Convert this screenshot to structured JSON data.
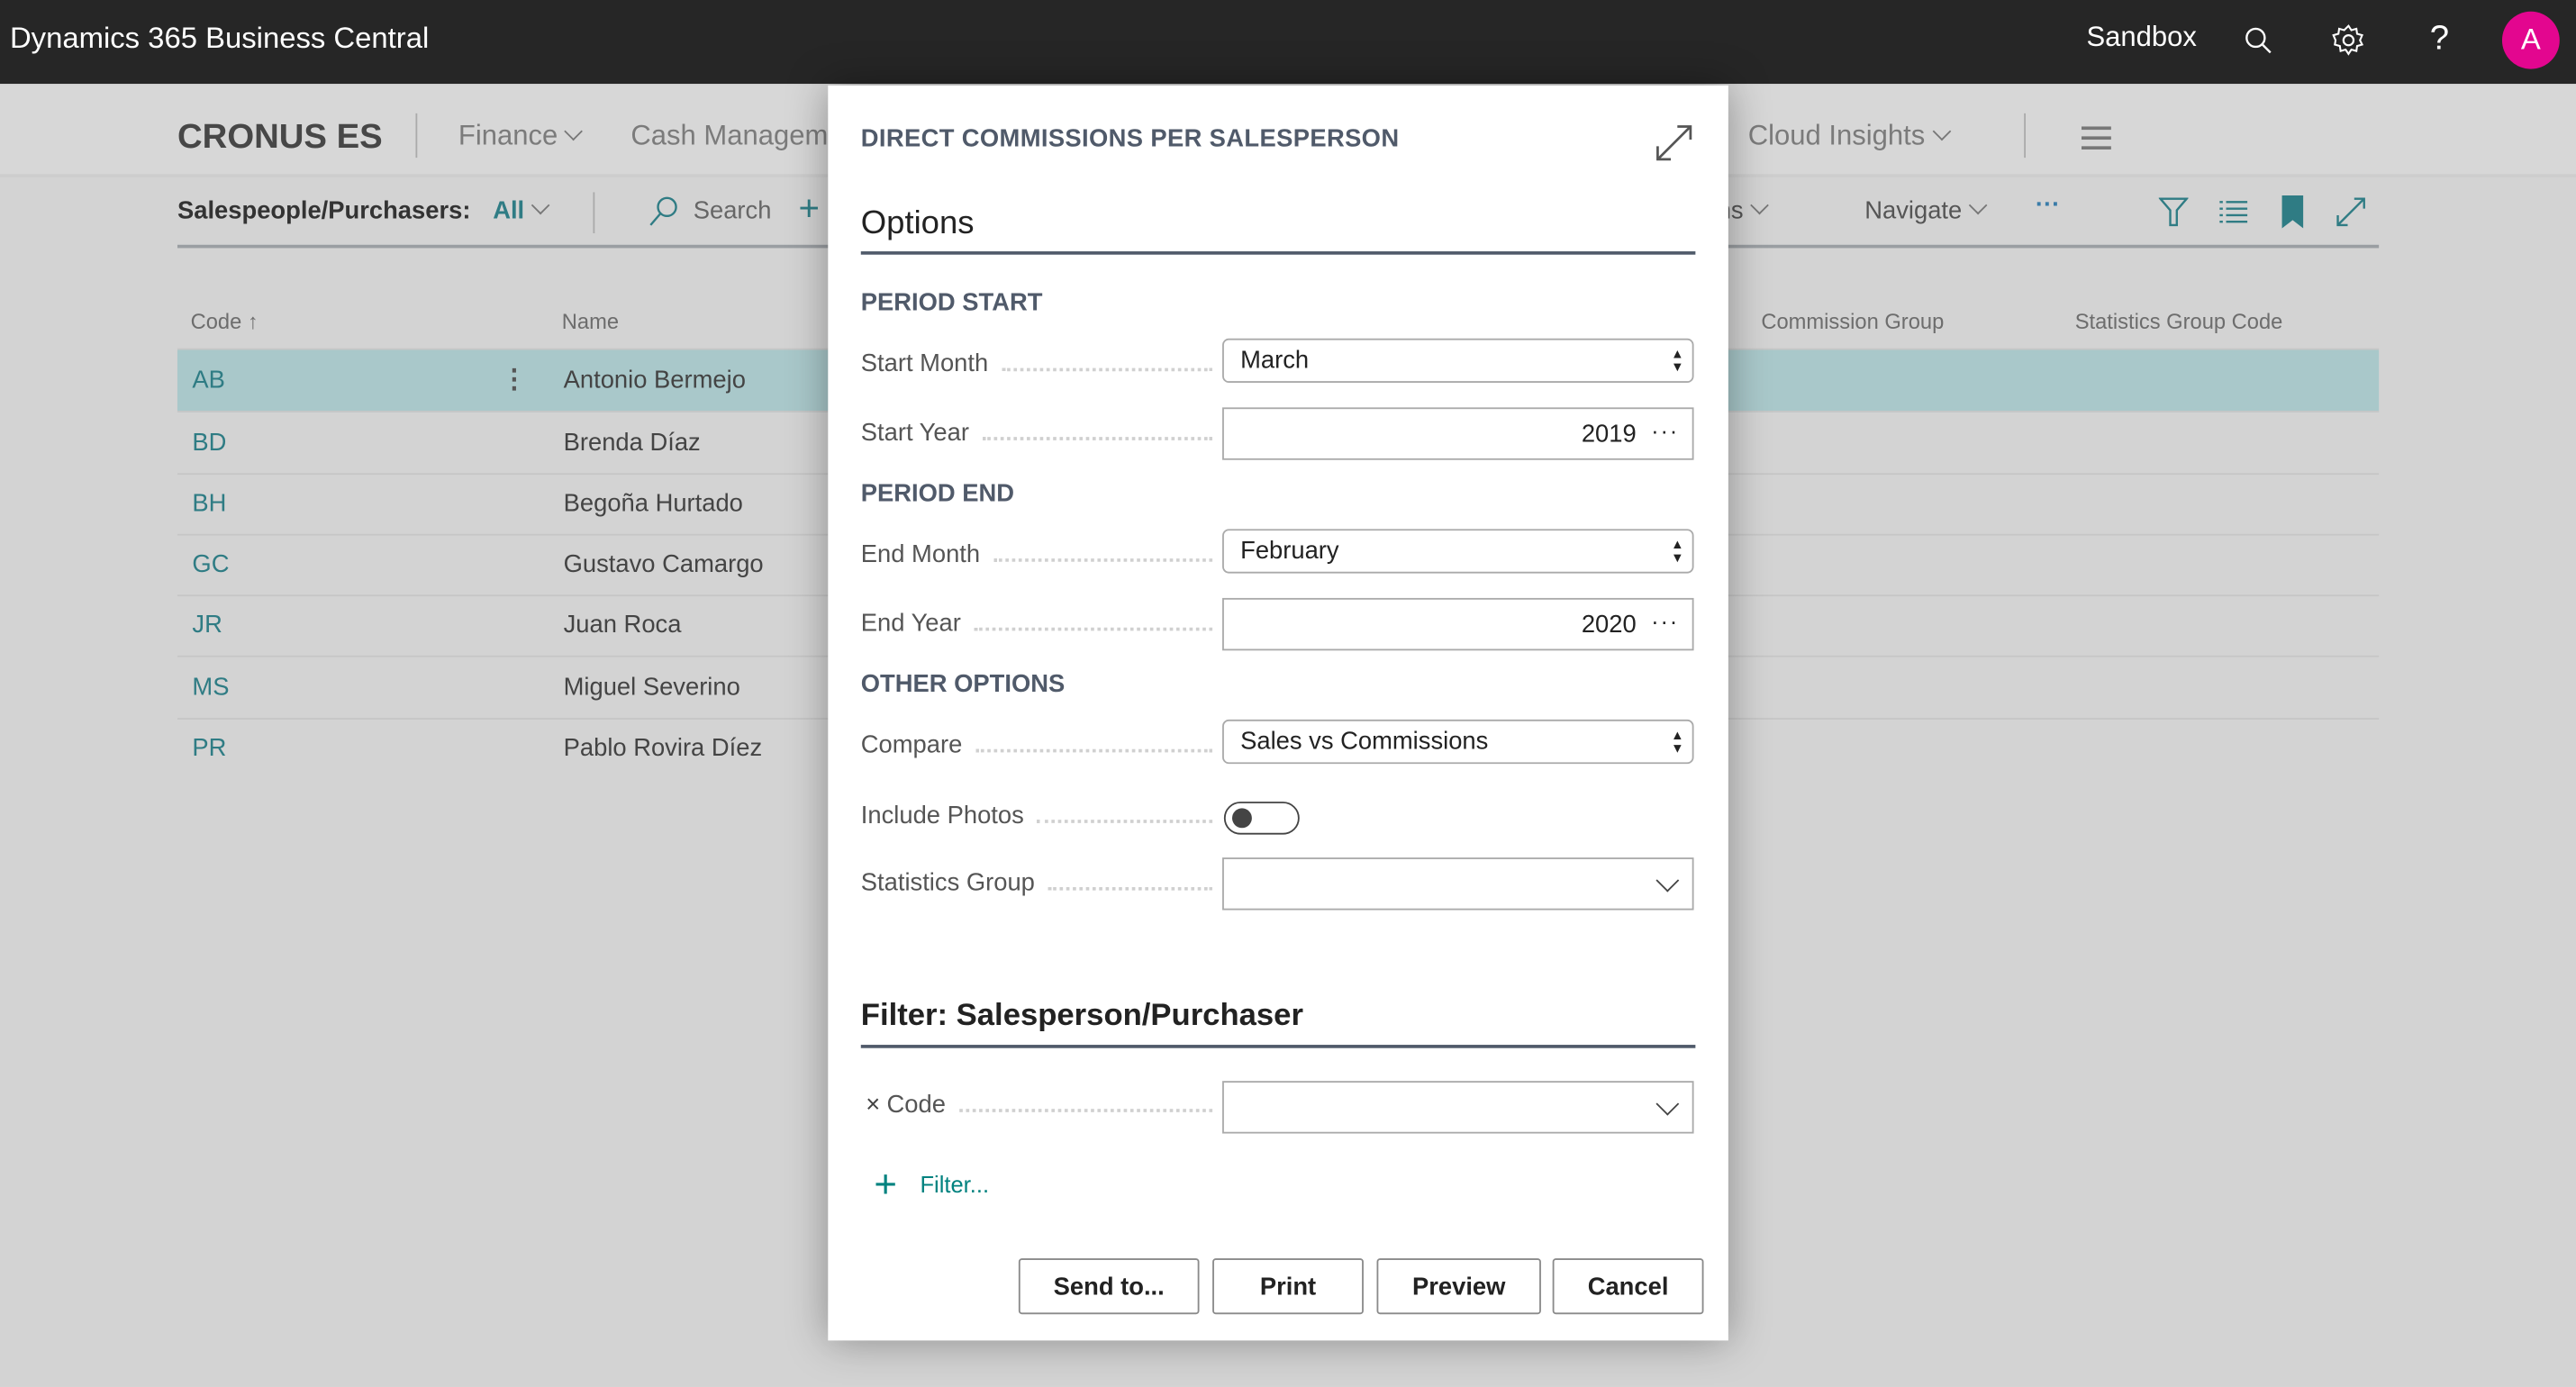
{
  "app": {
    "title": "Dynamics 365 Business Central",
    "environment": "Sandbox",
    "avatar_initial": "A",
    "avatar_color": "#e3068f",
    "icons": [
      "search-icon",
      "gear-icon",
      "help-icon"
    ]
  },
  "header": {
    "company": "CRONUS ES",
    "nav": [
      "Finance",
      "Cash Management",
      "Cloud Insights"
    ]
  },
  "toolbar": {
    "page_label": "Salespeople/Purchasers:",
    "view": "All",
    "search": "Search",
    "new_icon": "+",
    "actions": "Actions",
    "navigate": "Navigate",
    "more": "···"
  },
  "table": {
    "columns": [
      "Code",
      "Name",
      "Commission Group",
      "Statistics Group Code"
    ],
    "rows": [
      {
        "code": "AB",
        "name": "Antonio Bermejo"
      },
      {
        "code": "BD",
        "name": "Brenda Díaz"
      },
      {
        "code": "BH",
        "name": "Begoña Hurtado"
      },
      {
        "code": "GC",
        "name": "Gustavo Camargo"
      },
      {
        "code": "JR",
        "name": "Juan Roca"
      },
      {
        "code": "MS",
        "name": "Miguel Severino"
      },
      {
        "code": "PR",
        "name": "Pablo Rovira Díez"
      }
    ]
  },
  "dialog": {
    "title": "DIRECT COMMISSIONS PER SALESPERSON",
    "options_heading": "Options",
    "period_start": "PERIOD START",
    "start_month_label": "Start Month",
    "start_month": "March",
    "start_year_label": "Start Year",
    "start_year": "2019",
    "period_end": "PERIOD END",
    "end_month_label": "End Month",
    "end_month": "February",
    "end_year_label": "End Year",
    "end_year": "2020",
    "other_options": "OTHER OPTIONS",
    "compare_label": "Compare",
    "compare": "Sales vs Commissions",
    "include_photos_label": "Include Photos",
    "include_photos": false,
    "statistics_group_label": "Statistics Group",
    "statistics_group": "",
    "filter_heading": "Filter: Salesperson/Purchaser",
    "code_filter_label": "Code",
    "code_filter": "",
    "add_filter": "Filter...",
    "buttons": {
      "send_to": "Send to...",
      "print": "Print",
      "preview": "Preview",
      "cancel": "Cancel"
    },
    "accent": "#00827f"
  }
}
